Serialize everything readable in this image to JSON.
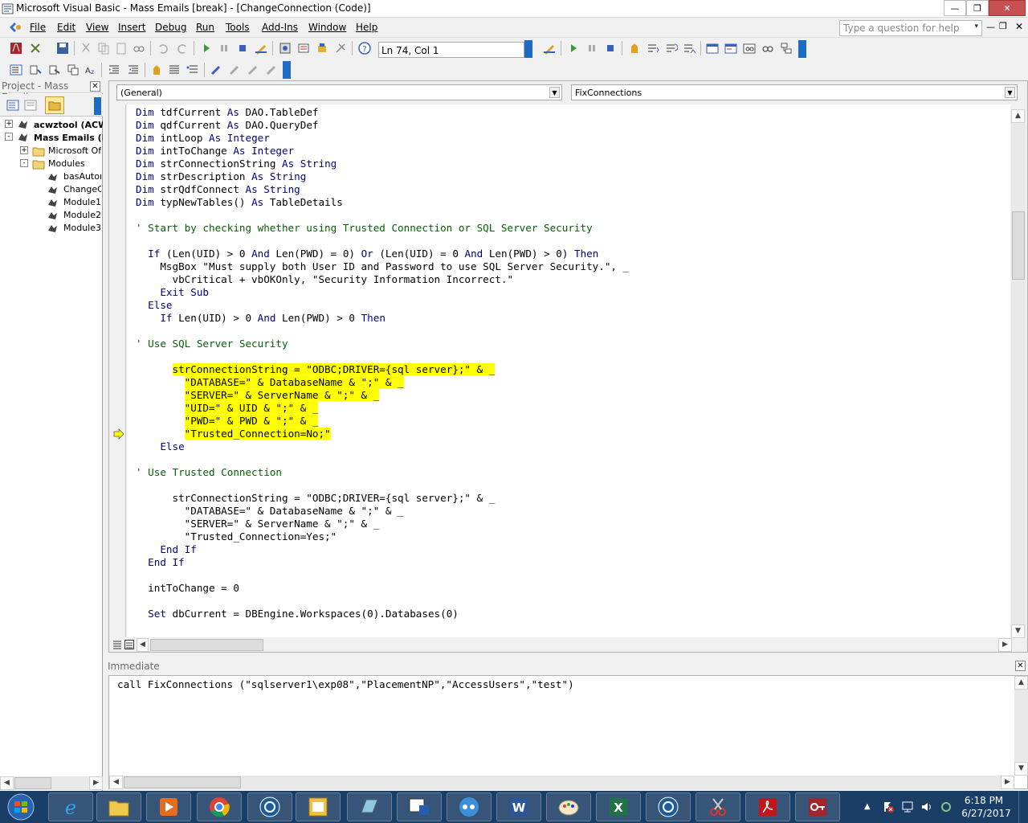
{
  "window": {
    "title": "Microsoft Visual Basic - Mass Emails [break] - [ChangeConnection (Code)]"
  },
  "menu": [
    "File",
    "Edit",
    "View",
    "Insert",
    "Debug",
    "Run",
    "Tools",
    "Add-Ins",
    "Window",
    "Help"
  ],
  "help_placeholder": "Type a question for help",
  "toolbar": {
    "position": "Ln 74, Col 1"
  },
  "project": {
    "title": "Project - Mass Emails",
    "tree": [
      {
        "label": "acwztool (ACW",
        "bold": true,
        "expander": "+"
      },
      {
        "label": "Mass Emails (M",
        "bold": true,
        "expander": "-"
      },
      {
        "label": "Microsoft Offi",
        "bold": false,
        "expander": "+"
      },
      {
        "label": "Modules",
        "bold": false,
        "expander": "-"
      },
      {
        "label": "basAutom",
        "bold": false,
        "expander": ""
      },
      {
        "label": "ChangeC",
        "bold": false,
        "expander": ""
      },
      {
        "label": "Module1",
        "bold": false,
        "expander": ""
      },
      {
        "label": "Module2",
        "bold": false,
        "expander": ""
      },
      {
        "label": "Module3",
        "bold": false,
        "expander": ""
      }
    ]
  },
  "code": {
    "object_combo": "(General)",
    "proc_combo": "FixConnections",
    "lines": [
      [
        [
          "kw",
          "Dim "
        ],
        [
          "",
          "tdfCurrent "
        ],
        [
          "kw",
          "As "
        ],
        [
          "",
          "DAO.TableDef"
        ]
      ],
      [
        [
          "kw",
          "Dim "
        ],
        [
          "",
          "qdfCurrent "
        ],
        [
          "kw",
          "As "
        ],
        [
          "",
          "DAO.QueryDef"
        ]
      ],
      [
        [
          "kw",
          "Dim "
        ],
        [
          "",
          "intLoop "
        ],
        [
          "kw",
          "As Integer"
        ]
      ],
      [
        [
          "kw",
          "Dim "
        ],
        [
          "",
          "intToChange "
        ],
        [
          "kw",
          "As Integer"
        ]
      ],
      [
        [
          "kw",
          "Dim "
        ],
        [
          "",
          "strConnectionString "
        ],
        [
          "kw",
          "As String"
        ]
      ],
      [
        [
          "kw",
          "Dim "
        ],
        [
          "",
          "strDescription "
        ],
        [
          "kw",
          "As String"
        ]
      ],
      [
        [
          "kw",
          "Dim "
        ],
        [
          "",
          "strQdfConnect "
        ],
        [
          "kw",
          "As String"
        ]
      ],
      [
        [
          "kw",
          "Dim "
        ],
        [
          "",
          "typNewTables() "
        ],
        [
          "kw",
          "As "
        ],
        [
          "",
          "TableDetails"
        ]
      ],
      [],
      [
        [
          "cm",
          "' Start by checking whether using Trusted Connection or SQL Server Security"
        ]
      ],
      [],
      [
        [
          "",
          "  "
        ],
        [
          "kw",
          "If "
        ],
        [
          "",
          "(Len(UID) > 0 "
        ],
        [
          "kw",
          "And "
        ],
        [
          "",
          "Len(PWD) = 0) "
        ],
        [
          "kw",
          "Or "
        ],
        [
          "",
          "(Len(UID) = 0 "
        ],
        [
          "kw",
          "And "
        ],
        [
          "",
          "Len(PWD) > 0) "
        ],
        [
          "kw",
          "Then"
        ]
      ],
      [
        [
          "",
          "    MsgBox \"Must supply both User ID and Password to use SQL Server Security.\", _"
        ]
      ],
      [
        [
          "",
          "      vbCritical + vbOKOnly, \"Security Information Incorrect.\""
        ]
      ],
      [
        [
          "",
          "    "
        ],
        [
          "kw",
          "Exit Sub"
        ]
      ],
      [
        [
          "",
          "  "
        ],
        [
          "kw",
          "Else"
        ]
      ],
      [
        [
          "",
          "    "
        ],
        [
          "kw",
          "If "
        ],
        [
          "",
          "Len(UID) > 0 "
        ],
        [
          "kw",
          "And "
        ],
        [
          "",
          "Len(PWD) > 0 "
        ],
        [
          "kw",
          "Then"
        ]
      ],
      [],
      [
        [
          "cm",
          "' Use SQL Server Security"
        ]
      ],
      [],
      [
        [
          "",
          "      "
        ],
        [
          "hl",
          "strConnectionString = \"ODBC;DRIVER={sql server};\" & _"
        ]
      ],
      [
        [
          "",
          "        "
        ],
        [
          "hl",
          "\"DATABASE=\" & DatabaseName & \";\" & _"
        ]
      ],
      [
        [
          "",
          "        "
        ],
        [
          "hl",
          "\"SERVER=\" & ServerName & \";\" & _"
        ]
      ],
      [
        [
          "",
          "        "
        ],
        [
          "hl",
          "\"UID=\" & UID & \";\" & _"
        ]
      ],
      [
        [
          "",
          "        "
        ],
        [
          "hl",
          "\"PWD=\" & PWD & \";\" & _"
        ]
      ],
      [
        [
          "",
          "        "
        ],
        [
          "hl",
          "\"Trusted_Connection=No;\""
        ]
      ],
      [
        [
          "",
          "    "
        ],
        [
          "kw",
          "Else"
        ]
      ],
      [],
      [
        [
          "cm",
          "' Use Trusted Connection"
        ]
      ],
      [],
      [
        [
          "",
          "      strConnectionString = \"ODBC;DRIVER={sql server};\" & _"
        ]
      ],
      [
        [
          "",
          "        \"DATABASE=\" & DatabaseName & \";\" & _"
        ]
      ],
      [
        [
          "",
          "        \"SERVER=\" & ServerName & \";\" & _"
        ]
      ],
      [
        [
          "",
          "        \"Trusted_Connection=Yes;\""
        ]
      ],
      [
        [
          "",
          "    "
        ],
        [
          "kw",
          "End If"
        ]
      ],
      [
        [
          "",
          "  "
        ],
        [
          "kw",
          "End If"
        ]
      ],
      [],
      [
        [
          "",
          "  intToChange = 0"
        ]
      ],
      [],
      [
        [
          "",
          "  "
        ],
        [
          "kw",
          "Set "
        ],
        [
          "",
          "dbCurrent = DBEngine.Workspaces(0).Databases(0)"
        ]
      ]
    ]
  },
  "immediate": {
    "title": "Immediate",
    "text": "call FixConnections (\"sqlserver1\\exp08\",\"PlacementNP\",\"AccessUsers\",\"test\")"
  },
  "taskbar": {
    "time": "6:18 PM",
    "date": "6/27/2017",
    "apps": [
      "internet-explorer",
      "file-explorer",
      "media-player",
      "chrome",
      "remote-app",
      "access",
      "tablet",
      "vba",
      "meeting",
      "word",
      "paint",
      "excel",
      "remote-app-2",
      "snipping-tool",
      "acrobat",
      "access-key"
    ]
  }
}
